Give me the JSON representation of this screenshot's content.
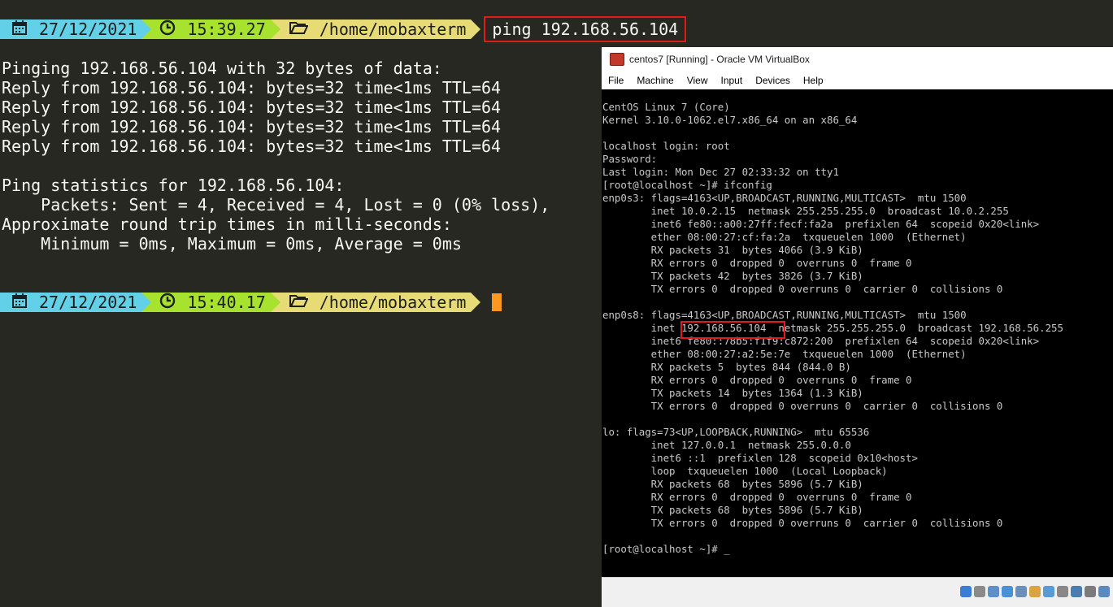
{
  "terminal": {
    "prompt1": {
      "date": "27/12/2021",
      "time": "15:39.27",
      "path": "/home/mobaxterm",
      "command": "ping 192.168.56.104"
    },
    "output_lines": [
      "Pinging 192.168.56.104 with 32 bytes of data:",
      "Reply from 192.168.56.104: bytes=32 time<1ms TTL=64",
      "Reply from 192.168.56.104: bytes=32 time<1ms TTL=64",
      "Reply from 192.168.56.104: bytes=32 time<1ms TTL=64",
      "Reply from 192.168.56.104: bytes=32 time<1ms TTL=64",
      "",
      "Ping statistics for 192.168.56.104:",
      "    Packets: Sent = 4, Received = 4, Lost = 0 (0% loss),",
      "Approximate round trip times in milli-seconds:",
      "    Minimum = 0ms, Maximum = 0ms, Average = 0ms"
    ],
    "prompt2": {
      "date": "27/12/2021",
      "time": "15:40.17",
      "path": "/home/mobaxterm"
    },
    "icons": {
      "date": "calendar-icon",
      "time": "clock-icon",
      "path": "folder-icon"
    },
    "colors": {
      "date_segment": "#62d0e6",
      "time_segment": "#a6e22e",
      "path_segment": "#e6db74",
      "cursor": "#fd971f",
      "highlight": "#e41a1a"
    }
  },
  "vbox": {
    "title": "centos7 [Running] - Oracle VM VirtualBox",
    "menu": [
      "File",
      "Machine",
      "View",
      "Input",
      "Devices",
      "Help"
    ],
    "console_lines": [
      "CentOS Linux 7 (Core)",
      "Kernel 3.10.0-1062.el7.x86_64 on an x86_64",
      "",
      "localhost login: root",
      "Password:",
      "Last login: Mon Dec 27 02:33:32 on tty1",
      "[root@localhost ~]# ifconfig",
      "enp0s3: flags=4163<UP,BROADCAST,RUNNING,MULTICAST>  mtu 1500",
      "        inet 10.0.2.15  netmask 255.255.255.0  broadcast 10.0.2.255",
      "        inet6 fe80::a00:27ff:fecf:fa2a  prefixlen 64  scopeid 0x20<link>",
      "        ether 08:00:27:cf:fa:2a  txqueuelen 1000  (Ethernet)",
      "        RX packets 31  bytes 4066 (3.9 KiB)",
      "        RX errors 0  dropped 0  overruns 0  frame 0",
      "        TX packets 42  bytes 3826 (3.7 KiB)",
      "        TX errors 0  dropped 0 overruns 0  carrier 0  collisions 0",
      "",
      "enp0s8: flags=4163<UP,BROADCAST,RUNNING,MULTICAST>  mtu 1500",
      "        inet 192.168.56.104  netmask 255.255.255.0  broadcast 192.168.56.255",
      "        inet6 fe80::78b5:f1f9:c872:200  prefixlen 64  scopeid 0x20<link>",
      "        ether 08:00:27:a2:5e:7e  txqueuelen 1000  (Ethernet)",
      "        RX packets 5  bytes 844 (844.0 B)",
      "        RX errors 0  dropped 0  overruns 0  frame 0",
      "        TX packets 14  bytes 1364 (1.3 KiB)",
      "        TX errors 0  dropped 0 overruns 0  carrier 0  collisions 0",
      "",
      "lo: flags=73<UP,LOOPBACK,RUNNING>  mtu 65536",
      "        inet 127.0.0.1  netmask 255.0.0.0",
      "        inet6 ::1  prefixlen 128  scopeid 0x10<host>",
      "        loop  txqueuelen 1000  (Local Loopback)",
      "        RX packets 68  bytes 5896 (5.7 KiB)",
      "        RX errors 0  dropped 0  overruns 0  frame 0",
      "        TX packets 68  bytes 5896 (5.7 KiB)",
      "        TX errors 0  dropped 0 overruns 0  carrier 0  collisions 0",
      "",
      "[root@localhost ~]# _"
    ],
    "status_icons": [
      "hdd-icon",
      "optical-disc-icon",
      "audio-icon",
      "network-icon",
      "usb-icon",
      "shared-folders-icon",
      "display-icon",
      "recording-icon",
      "cpu-icon",
      "mouse-icon",
      "keyboard-icon"
    ]
  }
}
